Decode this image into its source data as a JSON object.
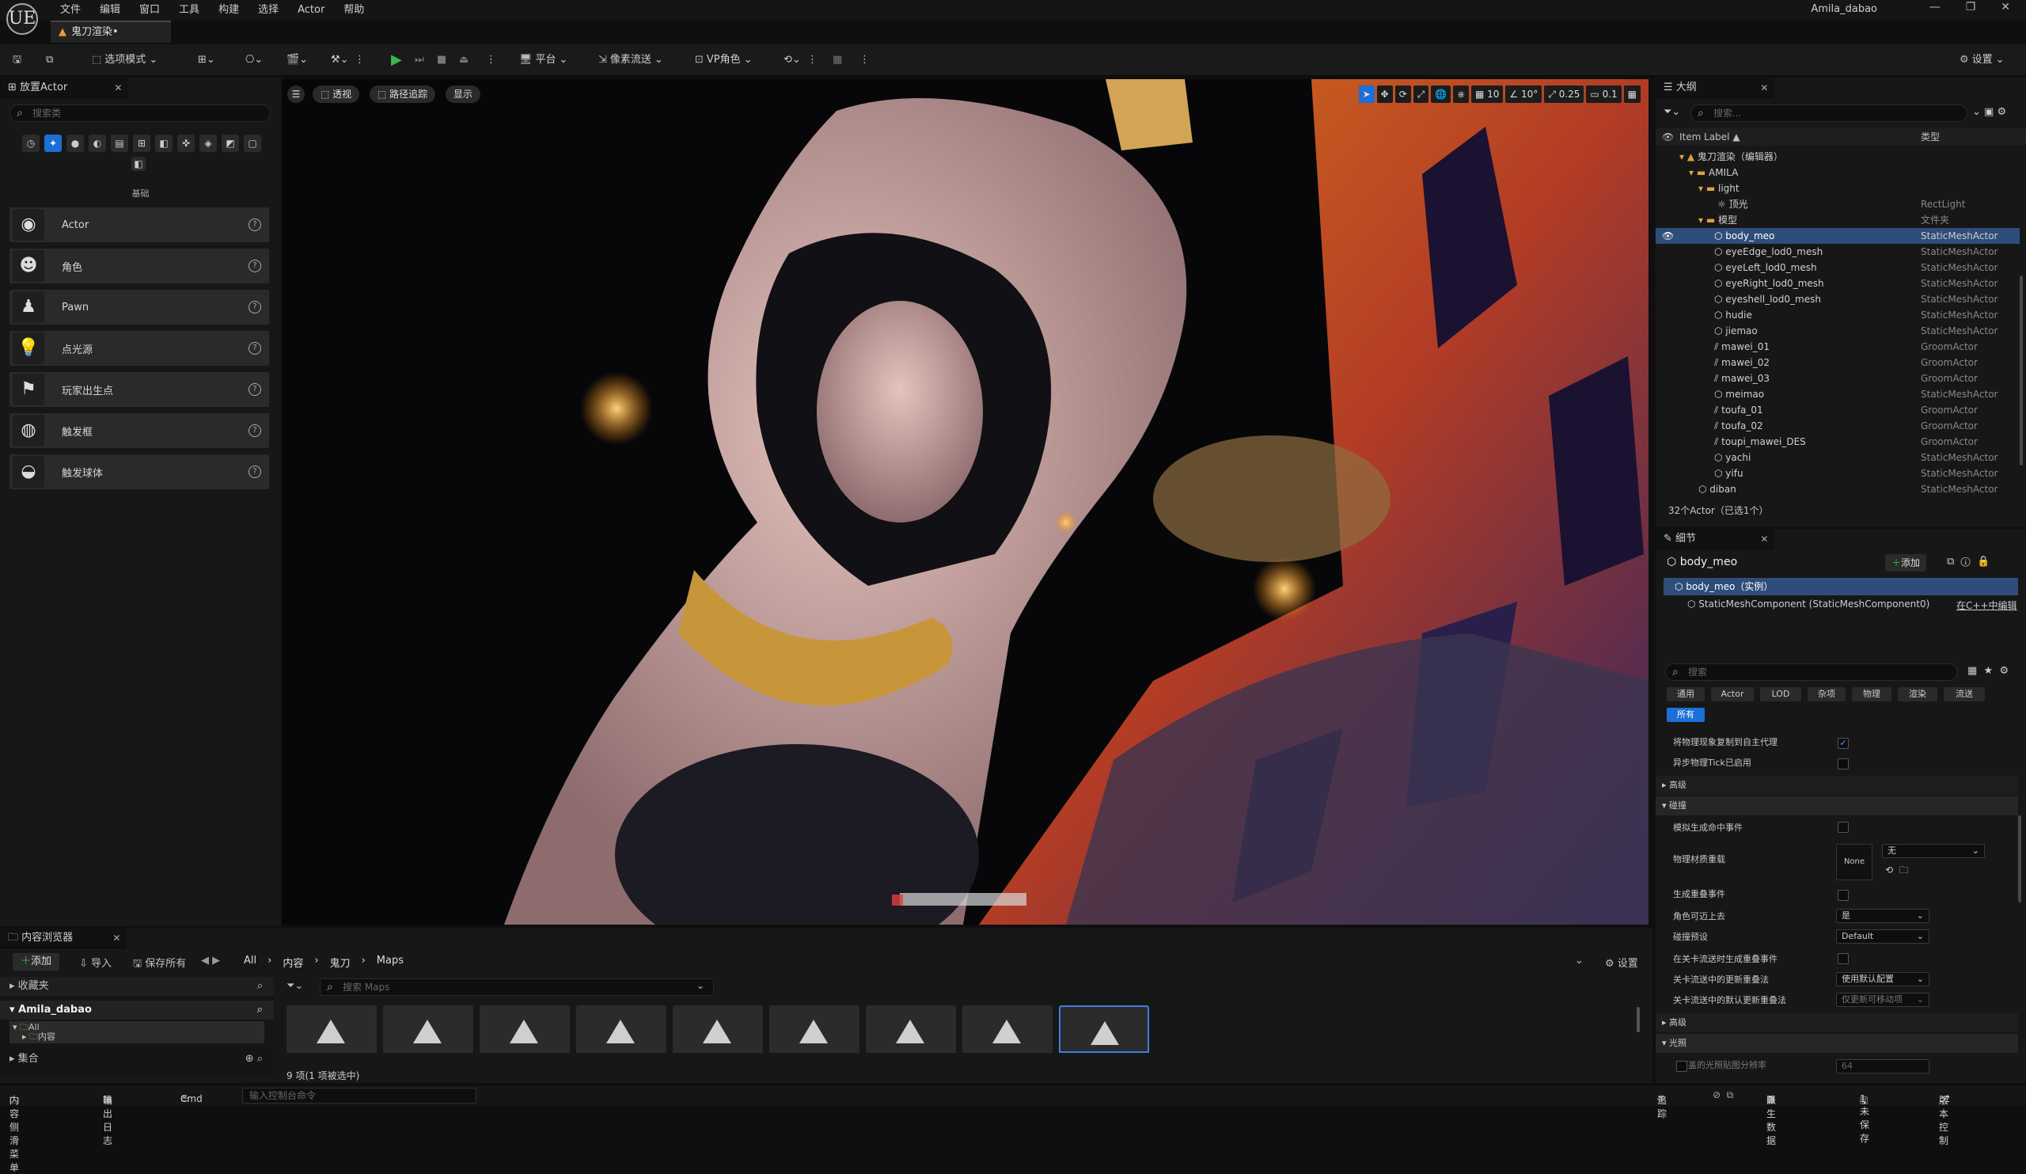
{
  "app": {
    "username": "Amila_dabao",
    "logo": "UE"
  },
  "menu": [
    "文件",
    "编辑",
    "窗口",
    "工具",
    "构建",
    "选择",
    "Actor",
    "帮助"
  ],
  "doc_tab": "鬼刀渲染•",
  "toolbar": {
    "mode": "选项模式",
    "platform": "平台",
    "pixel_stream": "像素流送",
    "vp_role": "VP角色",
    "settings": "设置"
  },
  "place_actor": {
    "tab": "放置Actor",
    "search_placeholder": "搜索类",
    "category": "基础",
    "items": [
      "Actor",
      "角色",
      "Pawn",
      "点光源",
      "玩家出生点",
      "触发框",
      "触发球体"
    ]
  },
  "viewport": {
    "perspective": "透视",
    "path_tracing": "路径追踪",
    "show": "显示",
    "grid": "10",
    "angle": "10°",
    "scale": "0.25",
    "cam": "0.1"
  },
  "outliner": {
    "tab": "大纲",
    "search_placeholder": "搜索...",
    "col_label": "Item Label ▲",
    "col_type": "类型",
    "rows": [
      {
        "label": "鬼刀渲染（编辑器）",
        "type": ""
      },
      {
        "label": "AMILA",
        "type": ""
      },
      {
        "label": "light",
        "type": ""
      },
      {
        "label": "顶光",
        "type": "RectLight"
      },
      {
        "label": "模型",
        "type": "文件夹"
      },
      {
        "label": "body_meo",
        "type": "StaticMeshActor"
      },
      {
        "label": "eyeEdge_lod0_mesh",
        "type": "StaticMeshActor"
      },
      {
        "label": "eyeLeft_lod0_mesh",
        "type": "StaticMeshActor"
      },
      {
        "label": "eyeRight_lod0_mesh",
        "type": "StaticMeshActor"
      },
      {
        "label": "eyeshell_lod0_mesh",
        "type": "StaticMeshActor"
      },
      {
        "label": "hudie",
        "type": "StaticMeshActor"
      },
      {
        "label": "jiemao",
        "type": "StaticMeshActor"
      },
      {
        "label": "mawei_01",
        "type": "GroomActor"
      },
      {
        "label": "mawei_02",
        "type": "GroomActor"
      },
      {
        "label": "mawei_03",
        "type": "GroomActor"
      },
      {
        "label": "meimao",
        "type": "StaticMeshActor"
      },
      {
        "label": "toufa_01",
        "type": "GroomActor"
      },
      {
        "label": "toufa_02",
        "type": "GroomActor"
      },
      {
        "label": "toupi_mawei_DES",
        "type": "GroomActor"
      },
      {
        "label": "yachi",
        "type": "StaticMeshActor"
      },
      {
        "label": "yifu",
        "type": "StaticMeshActor"
      },
      {
        "label": "diban",
        "type": "StaticMeshActor"
      }
    ],
    "count": "32个Actor（已选1个）"
  },
  "details": {
    "tab": "细节",
    "actor_name": "body_meo",
    "add": "添加",
    "instance": "body_meo（实例）",
    "component": "StaticMeshComponent (StaticMeshComponent0)",
    "edit_cpp": "在C++中编辑",
    "search_placeholder": "搜索",
    "cat_tabs": [
      "通用",
      "Actor",
      "LOD",
      "杂项",
      "物理",
      "渲染",
      "流送"
    ],
    "all": "所有",
    "rows": {
      "r1": "将物理现象复制到自主代理",
      "r2": "异步物理Tick已启用",
      "advanced1": "高级",
      "collision": "碰撞",
      "sim_hit": "模拟生成命中事件",
      "phys_mat": "物理材质重载",
      "none": "None",
      "no": "无",
      "gen_overlap": "生成重叠事件",
      "can_step": "角色可迈上去",
      "yes": "是",
      "preset": "碰撞预设",
      "default": "Default",
      "level_stream": "在关卡流送时生成重叠事件",
      "update_method": "关卡流送中的更新重叠法",
      "use_default": "使用默认配置",
      "default_update": "关卡流送中的默认更新重叠法",
      "movable_only": "仅更新可移动项",
      "advanced2": "高级",
      "lighting": "光照",
      "override_res": "覆盖的光照贴图分辨率",
      "res_val": "64"
    }
  },
  "content_browser": {
    "tab": "内容浏览器",
    "add": "添加",
    "import": "导入",
    "save_all": "保存所有",
    "crumbs": [
      "All",
      "内容",
      "鬼刀",
      "Maps"
    ],
    "settings": "设置",
    "favorites": "收藏夹",
    "user": "Amila_dabao",
    "tree_all": "All",
    "tree_content": "内容",
    "collections": "集合",
    "search_placeholder": "搜索 Maps",
    "status": "9 项(1 项被选中)"
  },
  "statusbar": {
    "drawer": "内容侧滑菜单",
    "log": "输出日志",
    "cmd": "Cmd",
    "cmd_placeholder": "输入控制台命令",
    "trace": "追踪",
    "derived": "派生数据",
    "unsaved": "1未保存",
    "source": "版本控制"
  }
}
